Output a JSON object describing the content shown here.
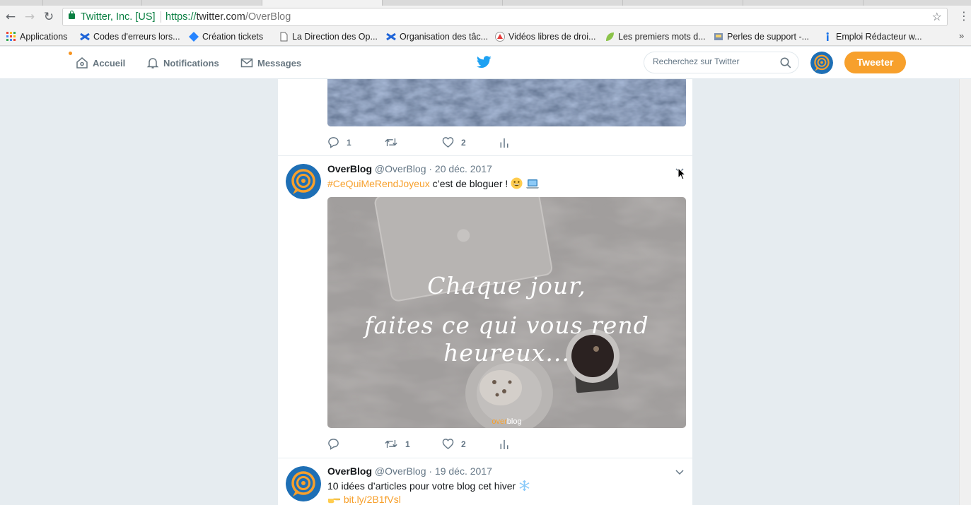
{
  "browser": {
    "site_identity": "Twitter, Inc. [US]",
    "url_scheme": "https://",
    "url_host": "twitter.com",
    "url_path": "/OverBlog"
  },
  "bookmarks": [
    {
      "label": "Applications",
      "icon": "apps-grid-icon"
    },
    {
      "label": "Codes d'erreurs lors...",
      "icon": "confluence-icon"
    },
    {
      "label": "Création tickets",
      "icon": "jira-diamond-icon"
    },
    {
      "label": "La Direction des Op...",
      "icon": "page-icon"
    },
    {
      "label": "Organisation des tâc...",
      "icon": "confluence-icon"
    },
    {
      "label": "Vidéos libres de droi...",
      "icon": "video-site-icon"
    },
    {
      "label": "Les premiers mots d...",
      "icon": "leaf-icon"
    },
    {
      "label": "Perles de support -...",
      "icon": "site-icon"
    },
    {
      "label": "Emploi Rédacteur w...",
      "icon": "info-icon"
    }
  ],
  "twitter": {
    "nav": {
      "home": "Accueil",
      "notifications": "Notifications",
      "messages": "Messages"
    },
    "search_placeholder": "Recherchez sur Twitter",
    "tweet_button": "Tweeter",
    "accent_color": "#f7a02c"
  },
  "tweets": [
    {
      "replies": "1",
      "retweets": "",
      "likes": "2"
    },
    {
      "name": "OverBlog",
      "meta": "@OverBlog · 20 déc. 2017",
      "hashtag": "#CeQuiMeRendJoyeux",
      "text": " c’est de bloguer ! ",
      "image_line1": "Chaque jour,",
      "image_line2": "faites ce qui vous rend heureux...",
      "image_brand_a": "over",
      "image_brand_b": "blog",
      "replies": "",
      "retweets": "1",
      "likes": "2"
    },
    {
      "name": "OverBlog",
      "meta": "@OverBlog · 19 déc. 2017",
      "text": "10 idées d’articles pour votre blog cet hiver ",
      "link": "bit.ly/2B1fVsl"
    }
  ]
}
